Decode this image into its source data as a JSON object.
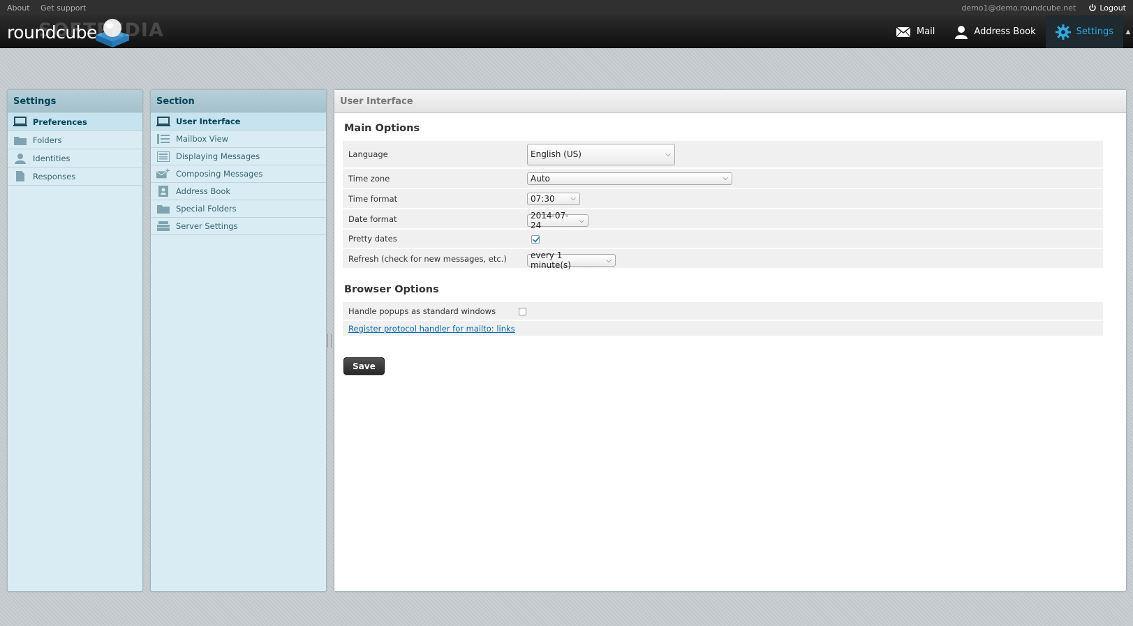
{
  "topbar": {
    "about": "About",
    "support": "Get support",
    "user_email": "demo1@demo.roundcube.net",
    "logout": "Logout"
  },
  "header": {
    "logo_text": "roundcube",
    "watermark": "SOFTPEDIA",
    "nav": {
      "mail": "Mail",
      "address_book": "Address Book",
      "settings": "Settings"
    },
    "active_color": "#2fa9e2"
  },
  "settings_panel": {
    "title": "Settings",
    "items": [
      {
        "label": "Preferences",
        "icon": "monitor-icon",
        "selected": true
      },
      {
        "label": "Folders",
        "icon": "folder-icon"
      },
      {
        "label": "Identities",
        "icon": "person-icon"
      },
      {
        "label": "Responses",
        "icon": "document-icon"
      }
    ]
  },
  "section_panel": {
    "title": "Section",
    "items": [
      {
        "label": "User Interface",
        "icon": "monitor-icon",
        "selected": true
      },
      {
        "label": "Mailbox View",
        "icon": "list-icon"
      },
      {
        "label": "Displaying Messages",
        "icon": "message-icon"
      },
      {
        "label": "Composing Messages",
        "icon": "compose-icon"
      },
      {
        "label": "Address Book",
        "icon": "contact-card-icon"
      },
      {
        "label": "Special Folders",
        "icon": "folder-icon"
      },
      {
        "label": "Server Settings",
        "icon": "server-icon"
      }
    ]
  },
  "content": {
    "title": "User Interface",
    "main_options": {
      "legend": "Main Options",
      "language": {
        "label": "Language",
        "value": "English (US)"
      },
      "timezone": {
        "label": "Time zone",
        "value": "Auto"
      },
      "time_format": {
        "label": "Time format",
        "value": "07:30"
      },
      "date_format": {
        "label": "Date format",
        "value": "2014-07-24"
      },
      "pretty_dates": {
        "label": "Pretty dates",
        "checked": true
      },
      "refresh": {
        "label": "Refresh (check for new messages, etc.)",
        "value": "every 1 minute(s)"
      }
    },
    "browser_options": {
      "legend": "Browser Options",
      "popups": {
        "label": "Handle popups as standard windows",
        "checked": false
      },
      "protocol_link": "Register protocol handler for mailto: links"
    },
    "save_label": "Save"
  }
}
